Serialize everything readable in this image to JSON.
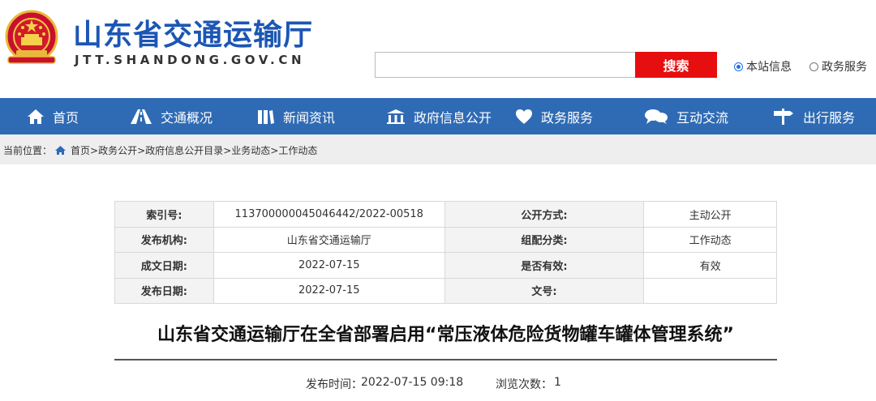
{
  "header": {
    "title": "山东省交通运输厅",
    "domain": "JTT.SHANDONG.GOV.CN",
    "search_button": "搜索",
    "search_placeholder": "",
    "radio_site": "本站信息",
    "radio_gov": "政务服务"
  },
  "nav": {
    "items": [
      {
        "label": "首页",
        "icon": "home-icon"
      },
      {
        "label": "交通概况",
        "icon": "road-icon"
      },
      {
        "label": "新闻资讯",
        "icon": "book-icon"
      },
      {
        "label": "政府信息公开",
        "icon": "building-icon"
      },
      {
        "label": "政务服务",
        "icon": "heart-icon"
      },
      {
        "label": "互动交流",
        "icon": "chat-icon"
      },
      {
        "label": "出行服务",
        "icon": "signpost-icon"
      }
    ]
  },
  "breadcrumb": {
    "prefix": "当前位置：",
    "items": [
      "首页",
      "政务公开",
      "政府信息公开目录",
      "业务动态",
      "工作动态"
    ],
    "sep": ">"
  },
  "info": {
    "rows": [
      {
        "k1": "索引号:",
        "v1": "113700000045046442/2022-00518",
        "k2": "公开方式:",
        "v2": "主动公开"
      },
      {
        "k1": "发布机构:",
        "v1": "山东省交通运输厅",
        "k2": "组配分类:",
        "v2": "工作动态"
      },
      {
        "k1": "成文日期:",
        "v1": "2022-07-15",
        "k2": "是否有效:",
        "v2": "有效"
      },
      {
        "k1": "发布日期:",
        "v1": "2022-07-15",
        "k2": "文号:",
        "v2": ""
      }
    ]
  },
  "article": {
    "title": "山东省交通运输厅在全省部署启用“常压液体危险货物罐车罐体管理系统”",
    "publish_label": "发布时间：",
    "publish_time": "2022-07-15 09:18",
    "views_label": "浏览次数：",
    "views": "1"
  },
  "colors": {
    "brand_blue": "#1b56b4",
    "nav_blue": "#2f6bb4",
    "search_red": "#e60e0e"
  }
}
